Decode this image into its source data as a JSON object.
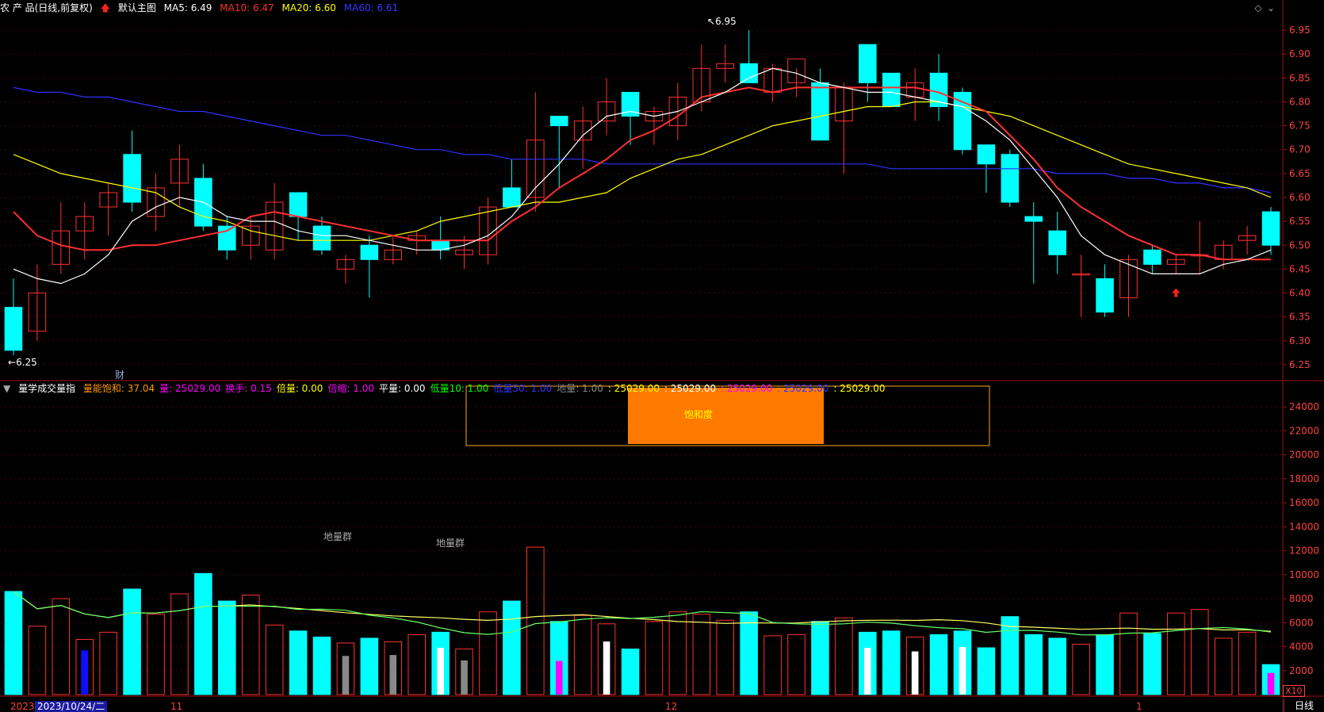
{
  "top_header": {
    "title": "农 产 品(日线,前复权)",
    "preset": "默认主图",
    "ma5": "MA5: 6.49",
    "ma10": "MA10: 6.47",
    "ma20": "MA20: 6.60",
    "ma60": "MA60: 6.61",
    "colors": {
      "ma5": "#ffffff",
      "ma10": "#ff3030",
      "ma20": "#ffff00",
      "ma60": "#3030ff"
    }
  },
  "vol_header": {
    "name": "量学成交量指",
    "items": [
      {
        "text": "量能饱和: 37.04",
        "color": "#ff9900"
      },
      {
        "text": "量: 25029.00",
        "color": "#ff00ff"
      },
      {
        "text": "换手: 0.15",
        "color": "#ff00ff"
      },
      {
        "text": "倍量: 0.00",
        "color": "#ffff00"
      },
      {
        "text": "倍缩: 1.00",
        "color": "#ff00ff"
      },
      {
        "text": "平量: 0.00",
        "color": "#ffffff"
      },
      {
        "text": "低量10: 1.00",
        "color": "#00ff00"
      },
      {
        "text": "低量50: 1.00",
        "color": "#3333ff"
      },
      {
        "text": "地量: 1.00",
        "color": "#888888"
      },
      {
        "text": ": 25029.00",
        "color": "#ffff00"
      },
      {
        "text": ": 25029.00",
        "color": "#ffffff"
      },
      {
        "text": ": 25029.00",
        "color": "#ff00ff"
      },
      {
        "text": ": 25029.00",
        "color": "#3333ff"
      },
      {
        "text": ": 25029.00",
        "color": "#ffff00"
      }
    ]
  },
  "annotations": {
    "high_label": "6.95",
    "low_label": "6.25",
    "cai": "财",
    "saturation": "饱和度",
    "ground_group_1": "地量群",
    "ground_group_2": "地量群",
    "x10": "X10"
  },
  "time_axis": {
    "year": "2023",
    "selected_date": "2023/10/24/二",
    "months": [
      "11",
      "12",
      "1"
    ]
  },
  "period_label": "日线",
  "chart_data": [
    {
      "type": "candlestick",
      "y_ticks": [
        6.25,
        6.3,
        6.35,
        6.4,
        6.45,
        6.5,
        6.55,
        6.6,
        6.65,
        6.7,
        6.75,
        6.8,
        6.85,
        6.9,
        6.95
      ],
      "ylim": [
        6.22,
        6.98
      ],
      "ohlc": [
        [
          6.37,
          6.43,
          6.27,
          6.28
        ],
        [
          6.32,
          6.46,
          6.3,
          6.4
        ],
        [
          6.46,
          6.59,
          6.44,
          6.53
        ],
        [
          6.53,
          6.59,
          6.47,
          6.56
        ],
        [
          6.58,
          6.63,
          6.52,
          6.61
        ],
        [
          6.69,
          6.74,
          6.57,
          6.59
        ],
        [
          6.56,
          6.65,
          6.53,
          6.62
        ],
        [
          6.63,
          6.71,
          6.58,
          6.68
        ],
        [
          6.64,
          6.67,
          6.53,
          6.54
        ],
        [
          6.54,
          6.56,
          6.47,
          6.49
        ],
        [
          6.5,
          6.56,
          6.47,
          6.54
        ],
        [
          6.49,
          6.63,
          6.47,
          6.59
        ],
        [
          6.61,
          6.61,
          6.51,
          6.56
        ],
        [
          6.54,
          6.56,
          6.48,
          6.49
        ],
        [
          6.45,
          6.48,
          6.42,
          6.47
        ],
        [
          6.5,
          6.52,
          6.39,
          6.47
        ],
        [
          6.47,
          6.52,
          6.46,
          6.49
        ],
        [
          6.51,
          6.53,
          6.48,
          6.52
        ],
        [
          6.51,
          6.56,
          6.47,
          6.49
        ],
        [
          6.48,
          6.52,
          6.45,
          6.49
        ],
        [
          6.48,
          6.6,
          6.46,
          6.58
        ],
        [
          6.62,
          6.68,
          6.58,
          6.58
        ],
        [
          6.6,
          6.82,
          6.57,
          6.72
        ],
        [
          6.77,
          6.76,
          6.62,
          6.75
        ],
        [
          6.72,
          6.79,
          6.66,
          6.76
        ],
        [
          6.76,
          6.85,
          6.73,
          6.8
        ],
        [
          6.82,
          6.81,
          6.71,
          6.77
        ],
        [
          6.76,
          6.79,
          6.71,
          6.78
        ],
        [
          6.75,
          6.84,
          6.72,
          6.81
        ],
        [
          6.8,
          6.92,
          6.78,
          6.87
        ],
        [
          6.87,
          6.92,
          6.84,
          6.88
        ],
        [
          6.88,
          6.95,
          6.84,
          6.84
        ],
        [
          6.82,
          6.88,
          6.8,
          6.87
        ],
        [
          6.84,
          6.87,
          6.81,
          6.89
        ],
        [
          6.84,
          6.87,
          6.72,
          6.72
        ],
        [
          6.76,
          6.84,
          6.65,
          6.83
        ],
        [
          6.92,
          6.92,
          6.8,
          6.84
        ],
        [
          6.86,
          6.86,
          6.79,
          6.79
        ],
        [
          6.81,
          6.87,
          6.76,
          6.84
        ],
        [
          6.86,
          6.9,
          6.76,
          6.79
        ],
        [
          6.82,
          6.83,
          6.69,
          6.7
        ],
        [
          6.71,
          6.7,
          6.61,
          6.67
        ],
        [
          6.69,
          6.7,
          6.58,
          6.59
        ],
        [
          6.56,
          6.59,
          6.42,
          6.55
        ],
        [
          6.53,
          6.57,
          6.44,
          6.48
        ],
        [
          6.44,
          6.48,
          6.35,
          6.44
        ],
        [
          6.43,
          6.46,
          6.35,
          6.36
        ],
        [
          6.39,
          6.48,
          6.35,
          6.47
        ],
        [
          6.49,
          6.5,
          6.44,
          6.46
        ],
        [
          6.46,
          6.48,
          6.44,
          6.47
        ],
        [
          6.48,
          6.55,
          6.44,
          6.48
        ],
        [
          6.47,
          6.51,
          6.45,
          6.5
        ],
        [
          6.51,
          6.54,
          6.48,
          6.52
        ],
        [
          6.57,
          6.58,
          6.48,
          6.5
        ]
      ],
      "ma5": [
        6.45,
        6.43,
        6.42,
        6.44,
        6.48,
        6.55,
        6.58,
        6.6,
        6.59,
        6.56,
        6.55,
        6.55,
        6.53,
        6.52,
        6.52,
        6.51,
        6.5,
        6.49,
        6.49,
        6.5,
        6.52,
        6.56,
        6.62,
        6.67,
        6.73,
        6.77,
        6.78,
        6.77,
        6.78,
        6.8,
        6.82,
        6.85,
        6.87,
        6.86,
        6.84,
        6.83,
        6.82,
        6.82,
        6.81,
        6.8,
        6.79,
        6.76,
        6.72,
        6.66,
        6.6,
        6.52,
        6.48,
        6.46,
        6.44,
        6.44,
        6.44,
        6.46,
        6.47,
        6.49
      ],
      "ma10": [
        6.57,
        6.52,
        6.5,
        6.49,
        6.49,
        6.5,
        6.5,
        6.51,
        6.52,
        6.53,
        6.56,
        6.57,
        6.56,
        6.55,
        6.54,
        6.53,
        6.52,
        6.51,
        6.51,
        6.51,
        6.51,
        6.55,
        6.58,
        6.62,
        6.65,
        6.68,
        6.72,
        6.74,
        6.77,
        6.81,
        6.82,
        6.83,
        6.82,
        6.83,
        6.83,
        6.83,
        6.83,
        6.83,
        6.83,
        6.82,
        6.8,
        6.78,
        6.73,
        6.68,
        6.62,
        6.58,
        6.55,
        6.52,
        6.5,
        6.48,
        6.48,
        6.47,
        6.47,
        6.47
      ],
      "ma20": [
        6.69,
        6.67,
        6.65,
        6.64,
        6.63,
        6.62,
        6.61,
        6.58,
        6.56,
        6.55,
        6.53,
        6.52,
        6.51,
        6.51,
        6.51,
        6.51,
        6.52,
        6.53,
        6.55,
        6.56,
        6.57,
        6.58,
        6.59,
        6.59,
        6.6,
        6.61,
        6.64,
        6.66,
        6.68,
        6.69,
        6.71,
        6.73,
        6.75,
        6.76,
        6.77,
        6.78,
        6.79,
        6.79,
        6.8,
        6.8,
        6.79,
        6.78,
        6.77,
        6.75,
        6.73,
        6.71,
        6.69,
        6.67,
        6.66,
        6.65,
        6.64,
        6.63,
        6.62,
        6.6
      ],
      "ma60": [
        6.83,
        6.82,
        6.82,
        6.81,
        6.81,
        6.8,
        6.79,
        6.78,
        6.78,
        6.77,
        6.76,
        6.75,
        6.74,
        6.73,
        6.73,
        6.72,
        6.71,
        6.7,
        6.7,
        6.69,
        6.69,
        6.68,
        6.68,
        6.68,
        6.68,
        6.67,
        6.67,
        6.67,
        6.67,
        6.67,
        6.67,
        6.67,
        6.67,
        6.67,
        6.67,
        6.67,
        6.67,
        6.66,
        6.66,
        6.66,
        6.66,
        6.66,
        6.66,
        6.66,
        6.65,
        6.65,
        6.65,
        6.64,
        6.64,
        6.63,
        6.63,
        6.62,
        6.62,
        6.61
      ],
      "ma_names": [
        "MA5",
        "MA10",
        "MA20",
        "MA60"
      ]
    },
    {
      "type": "bar",
      "y_ticks": [
        2000,
        4000,
        6000,
        8000,
        10000,
        12000,
        14000,
        16000,
        18000,
        20000,
        22000,
        24000
      ],
      "ylim": [
        0,
        25000
      ],
      "volume": [
        8600,
        5700,
        8000,
        4600,
        5200,
        8800,
        6700,
        8400,
        10100,
        7800,
        8300,
        5800,
        5300,
        4800,
        4300,
        4700,
        4400,
        5000,
        5200,
        3800,
        6900,
        7800,
        12300,
        6100,
        6600,
        5900,
        3800,
        6100,
        6900,
        6700,
        6200,
        6900,
        4900,
        5000,
        6100,
        6400,
        5200,
        5300,
        4800,
        5000,
        5300,
        3900,
        6500,
        5000,
        4700,
        4200,
        5000,
        6800,
        5100,
        6800,
        7100,
        4700,
        5200,
        2500
      ]
    }
  ]
}
